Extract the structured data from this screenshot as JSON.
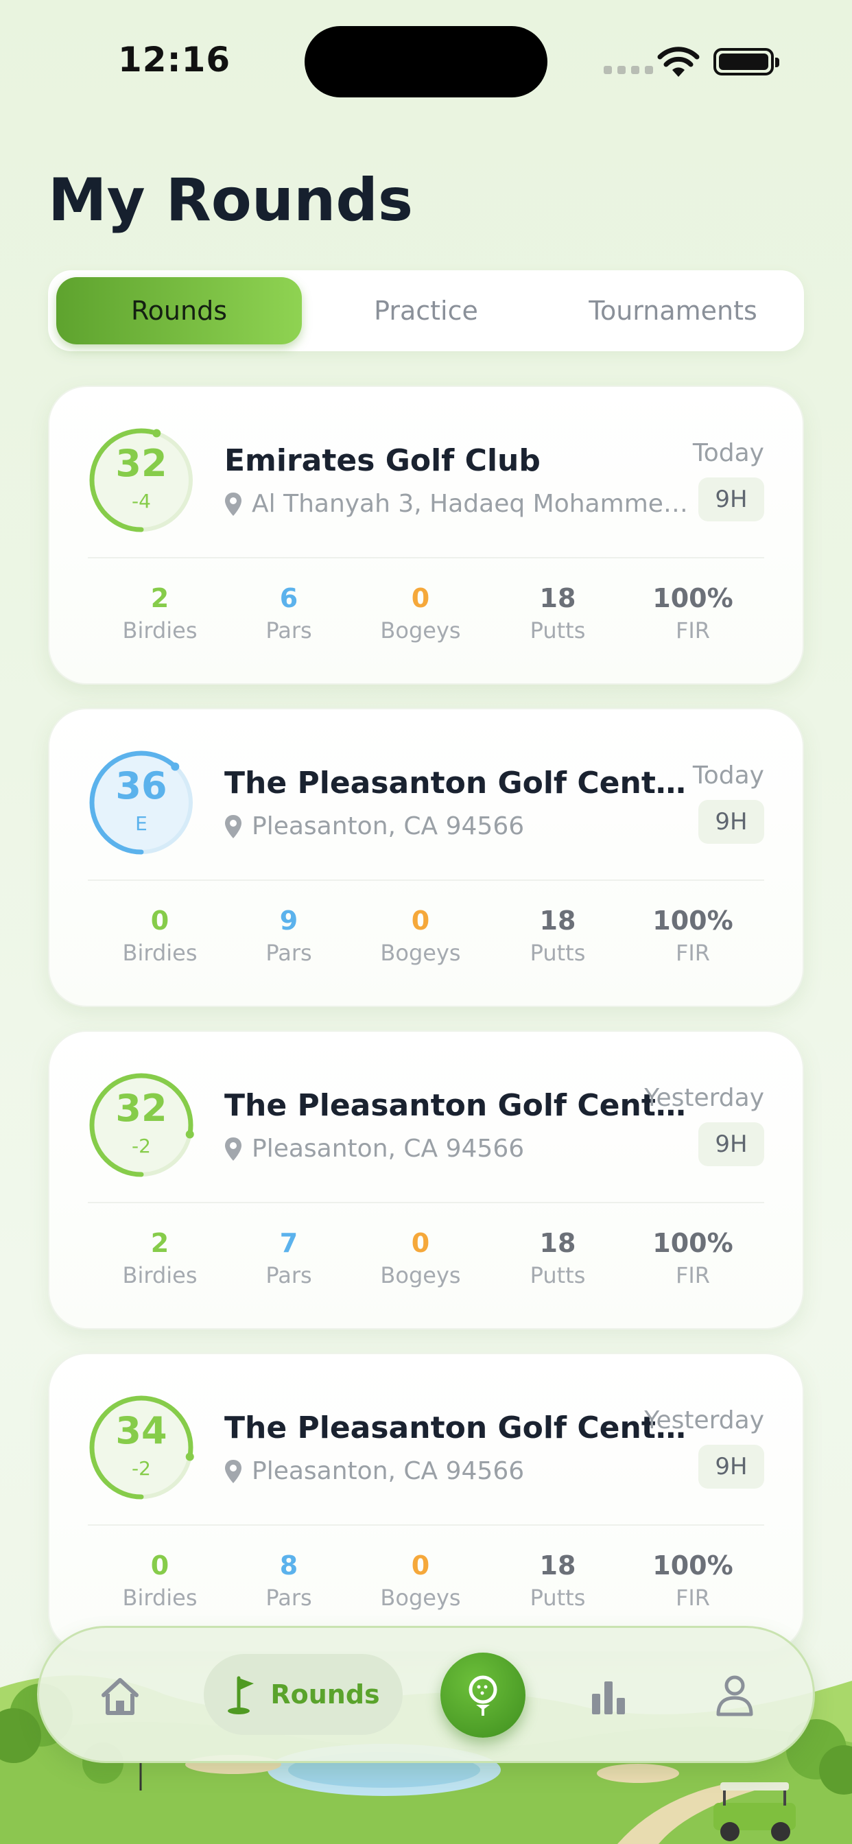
{
  "status_bar": {
    "time": "12:16"
  },
  "page": {
    "title": "My Rounds"
  },
  "segment": {
    "tabs": [
      {
        "label": "Rounds",
        "active": true
      },
      {
        "label": "Practice",
        "active": false
      },
      {
        "label": "Tournaments",
        "active": false
      }
    ]
  },
  "rounds": [
    {
      "score": "32",
      "diff": "-4",
      "ring_color": "#86cc4a",
      "progress": 0.55,
      "course": "Emirates Golf Club",
      "location": "Al Thanyah 3, Hadaeq Mohammed ...",
      "date": "Today",
      "holes": "9H",
      "stats": [
        {
          "value": "2",
          "label": "Birdies"
        },
        {
          "value": "6",
          "label": "Pars"
        },
        {
          "value": "0",
          "label": "Bogeys"
        },
        {
          "value": "18",
          "label": "Putts"
        },
        {
          "value": "100%",
          "label": "FIR"
        }
      ]
    },
    {
      "score": "36",
      "diff": "E",
      "ring_color": "#5bb2ec",
      "progress": 0.62,
      "course": "The Pleasanton Golf Center - ...",
      "location": "Pleasanton, CA 94566",
      "date": "Today",
      "holes": "9H",
      "stats": [
        {
          "value": "0",
          "label": "Birdies"
        },
        {
          "value": "9",
          "label": "Pars"
        },
        {
          "value": "0",
          "label": "Bogeys"
        },
        {
          "value": "18",
          "label": "Putts"
        },
        {
          "value": "100%",
          "label": "FIR"
        }
      ]
    },
    {
      "score": "32",
      "diff": "-2",
      "ring_color": "#86cc4a",
      "progress": 0.78,
      "course": "The Pleasanton Golf Cente...",
      "location": "Pleasanton, CA 94566",
      "date": "Yesterday",
      "holes": "9H",
      "stats": [
        {
          "value": "2",
          "label": "Birdies"
        },
        {
          "value": "7",
          "label": "Pars"
        },
        {
          "value": "0",
          "label": "Bogeys"
        },
        {
          "value": "18",
          "label": "Putts"
        },
        {
          "value": "100%",
          "label": "FIR"
        }
      ]
    },
    {
      "score": "34",
      "diff": "-2",
      "ring_color": "#86cc4a",
      "progress": 0.78,
      "course": "The Pleasanton Golf Cente...",
      "location": "Pleasanton, CA 94566",
      "date": "Yesterday",
      "holes": "9H",
      "stats": [
        {
          "value": "0",
          "label": "Birdies"
        },
        {
          "value": "8",
          "label": "Pars"
        },
        {
          "value": "0",
          "label": "Bogeys"
        },
        {
          "value": "18",
          "label": "Putts"
        },
        {
          "value": "100%",
          "label": "FIR"
        }
      ]
    }
  ],
  "bottom_nav": {
    "items": [
      {
        "icon": "home-icon"
      },
      {
        "icon": "golf-flag-icon",
        "label": "Rounds",
        "active": true
      },
      {
        "icon": "golf-ball-tee-icon"
      },
      {
        "icon": "bar-chart-icon"
      },
      {
        "icon": "profile-icon"
      }
    ]
  },
  "colors": {
    "accent_green": "#6cbf3a",
    "birdies": "#86cc4a",
    "pars": "#5bb2ec",
    "bogeys": "#f5a83a",
    "neutral": "#6b7078"
  }
}
